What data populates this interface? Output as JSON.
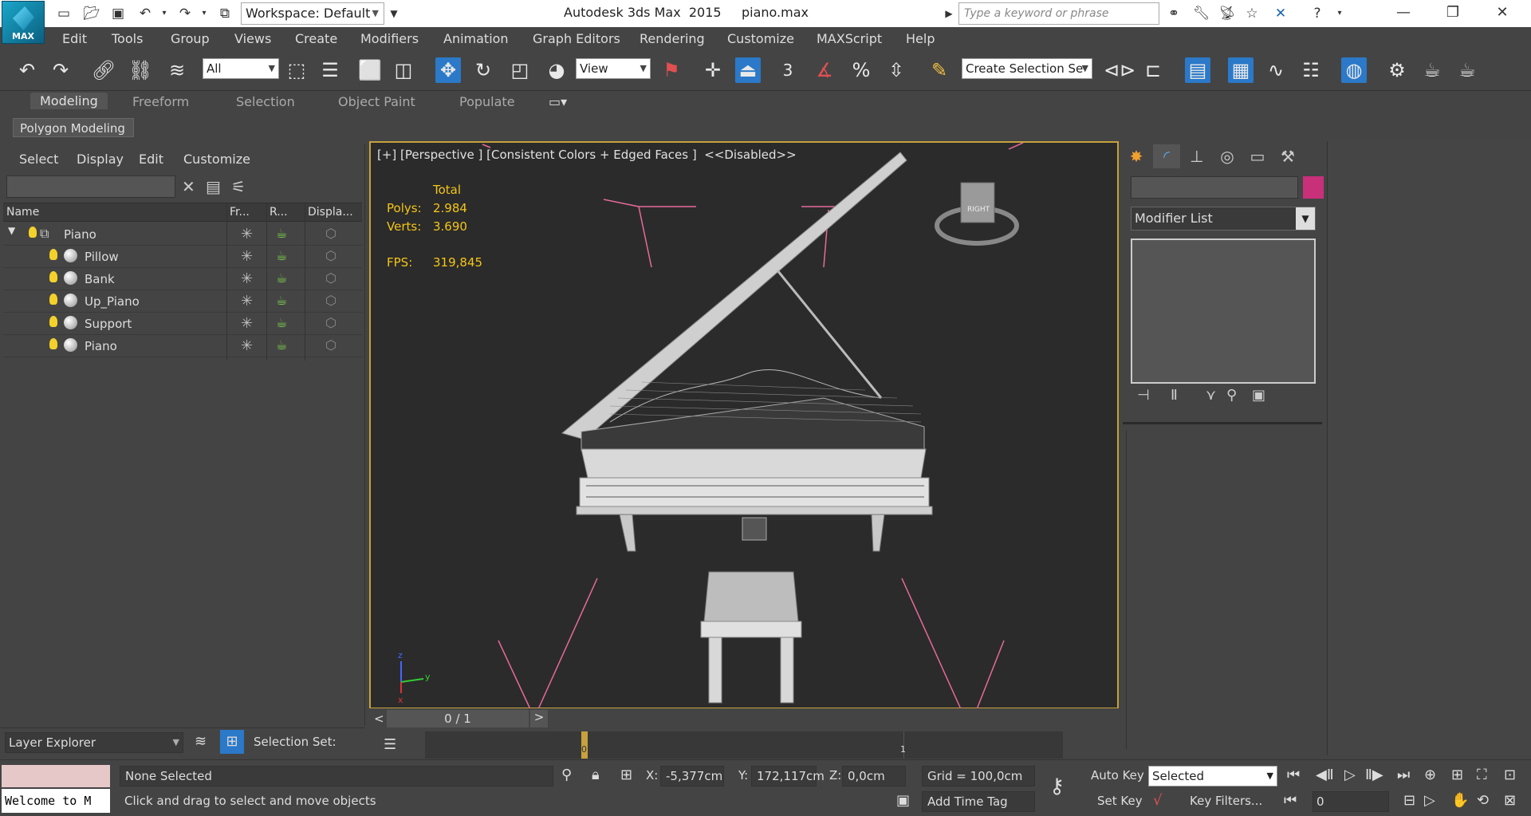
{
  "titlebar": {
    "workspace_label": "Workspace: Default",
    "app_title": "Autodesk 3ds Max  2015     piano.max",
    "search_placeholder": "Type a keyword or phrase",
    "logo_text": "MAX"
  },
  "menu": [
    "Edit",
    "Tools",
    "Group",
    "Views",
    "Create",
    "Modifiers",
    "Animation",
    "Graph Editors",
    "Rendering",
    "Customize",
    "MAXScript",
    "Help"
  ],
  "toolbar": {
    "selection_filter": "All",
    "ref_coord": "View",
    "named_selection": "Create Selection Se",
    "angle_snap": "3"
  },
  "ribbon": {
    "tabs": [
      "Modeling",
      "Freeform",
      "Selection",
      "Object Paint",
      "Populate"
    ],
    "active": "Modeling",
    "subpanel": "Polygon Modeling"
  },
  "explorer": {
    "menu": [
      "Select",
      "Display",
      "Edit",
      "Customize"
    ],
    "columns": [
      "Name",
      "Fr...",
      "R...",
      "Displa..."
    ],
    "rows": [
      {
        "name": "Piano",
        "level": 0
      },
      {
        "name": "Pillow",
        "level": 1
      },
      {
        "name": "Bank",
        "level": 1
      },
      {
        "name": "Up_Piano",
        "level": 1
      },
      {
        "name": "Support",
        "level": 1
      },
      {
        "name": "Piano",
        "level": 1
      }
    ],
    "layer_explorer": "Layer Explorer",
    "selection_set_label": "Selection Set:"
  },
  "viewport": {
    "label": "[+] [Perspective ] [Consistent Colors + Edged Faces ]  <<Disabled>>",
    "stats": {
      "total_label": "Total",
      "polys_label": "Polys:",
      "polys_value": "2.984",
      "verts_label": "Verts:",
      "verts_value": "3.690",
      "fps_label": "FPS:",
      "fps_value": "319,845"
    },
    "viewcube_label": "RIGHT",
    "axis": {
      "z": "z",
      "x": "x",
      "y": "y"
    }
  },
  "command_panel": {
    "modifier_list": "Modifier List",
    "color": "#c8307a"
  },
  "timeline": {
    "frame_counter": "0 / 1",
    "prev": "<",
    "next": ">",
    "key_marker_0": "0",
    "key_marker_1": "1"
  },
  "status": {
    "listener_text": "Welcome to M",
    "selection_status": "None Selected",
    "prompt": "Click and drag to select and move objects",
    "x_label": "X:",
    "x_value": "-5,377cm",
    "y_label": "Y:",
    "y_value": "172,117cm",
    "z_label": "Z:",
    "z_value": "0,0cm",
    "grid": "Grid = 100,0cm",
    "add_time_tag": "Add Time Tag",
    "auto_key": "Auto Key",
    "set_key": "Set Key",
    "selected_dropdown": "Selected",
    "key_filters": "Key Filters...",
    "current_frame": "0"
  }
}
